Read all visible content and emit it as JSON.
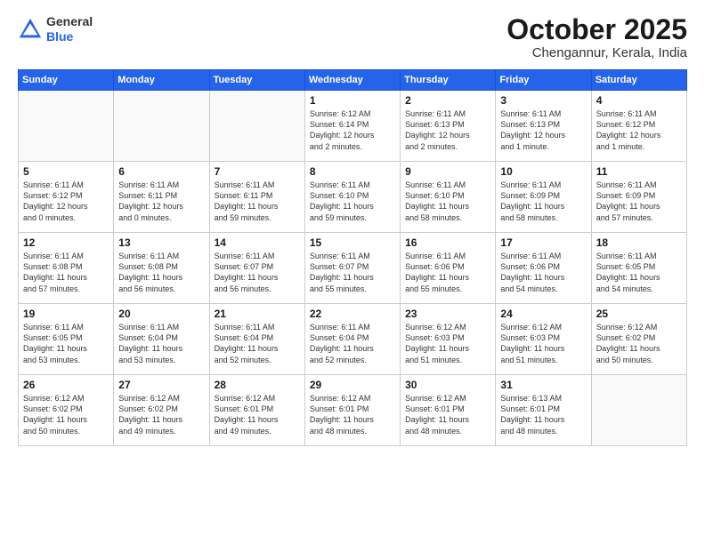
{
  "logo": {
    "general": "General",
    "blue": "Blue"
  },
  "header": {
    "title": "October 2025",
    "subtitle": "Chengannur, Kerala, India"
  },
  "weekdays": [
    "Sunday",
    "Monday",
    "Tuesday",
    "Wednesday",
    "Thursday",
    "Friday",
    "Saturday"
  ],
  "weeks": [
    [
      {
        "day": "",
        "info": ""
      },
      {
        "day": "",
        "info": ""
      },
      {
        "day": "",
        "info": ""
      },
      {
        "day": "1",
        "info": "Sunrise: 6:12 AM\nSunset: 6:14 PM\nDaylight: 12 hours\nand 2 minutes."
      },
      {
        "day": "2",
        "info": "Sunrise: 6:11 AM\nSunset: 6:13 PM\nDaylight: 12 hours\nand 2 minutes."
      },
      {
        "day": "3",
        "info": "Sunrise: 6:11 AM\nSunset: 6:13 PM\nDaylight: 12 hours\nand 1 minute."
      },
      {
        "day": "4",
        "info": "Sunrise: 6:11 AM\nSunset: 6:12 PM\nDaylight: 12 hours\nand 1 minute."
      }
    ],
    [
      {
        "day": "5",
        "info": "Sunrise: 6:11 AM\nSunset: 6:12 PM\nDaylight: 12 hours\nand 0 minutes."
      },
      {
        "day": "6",
        "info": "Sunrise: 6:11 AM\nSunset: 6:11 PM\nDaylight: 12 hours\nand 0 minutes."
      },
      {
        "day": "7",
        "info": "Sunrise: 6:11 AM\nSunset: 6:11 PM\nDaylight: 11 hours\nand 59 minutes."
      },
      {
        "day": "8",
        "info": "Sunrise: 6:11 AM\nSunset: 6:10 PM\nDaylight: 11 hours\nand 59 minutes."
      },
      {
        "day": "9",
        "info": "Sunrise: 6:11 AM\nSunset: 6:10 PM\nDaylight: 11 hours\nand 58 minutes."
      },
      {
        "day": "10",
        "info": "Sunrise: 6:11 AM\nSunset: 6:09 PM\nDaylight: 11 hours\nand 58 minutes."
      },
      {
        "day": "11",
        "info": "Sunrise: 6:11 AM\nSunset: 6:09 PM\nDaylight: 11 hours\nand 57 minutes."
      }
    ],
    [
      {
        "day": "12",
        "info": "Sunrise: 6:11 AM\nSunset: 6:08 PM\nDaylight: 11 hours\nand 57 minutes."
      },
      {
        "day": "13",
        "info": "Sunrise: 6:11 AM\nSunset: 6:08 PM\nDaylight: 11 hours\nand 56 minutes."
      },
      {
        "day": "14",
        "info": "Sunrise: 6:11 AM\nSunset: 6:07 PM\nDaylight: 11 hours\nand 56 minutes."
      },
      {
        "day": "15",
        "info": "Sunrise: 6:11 AM\nSunset: 6:07 PM\nDaylight: 11 hours\nand 55 minutes."
      },
      {
        "day": "16",
        "info": "Sunrise: 6:11 AM\nSunset: 6:06 PM\nDaylight: 11 hours\nand 55 minutes."
      },
      {
        "day": "17",
        "info": "Sunrise: 6:11 AM\nSunset: 6:06 PM\nDaylight: 11 hours\nand 54 minutes."
      },
      {
        "day": "18",
        "info": "Sunrise: 6:11 AM\nSunset: 6:05 PM\nDaylight: 11 hours\nand 54 minutes."
      }
    ],
    [
      {
        "day": "19",
        "info": "Sunrise: 6:11 AM\nSunset: 6:05 PM\nDaylight: 11 hours\nand 53 minutes."
      },
      {
        "day": "20",
        "info": "Sunrise: 6:11 AM\nSunset: 6:04 PM\nDaylight: 11 hours\nand 53 minutes."
      },
      {
        "day": "21",
        "info": "Sunrise: 6:11 AM\nSunset: 6:04 PM\nDaylight: 11 hours\nand 52 minutes."
      },
      {
        "day": "22",
        "info": "Sunrise: 6:11 AM\nSunset: 6:04 PM\nDaylight: 11 hours\nand 52 minutes."
      },
      {
        "day": "23",
        "info": "Sunrise: 6:12 AM\nSunset: 6:03 PM\nDaylight: 11 hours\nand 51 minutes."
      },
      {
        "day": "24",
        "info": "Sunrise: 6:12 AM\nSunset: 6:03 PM\nDaylight: 11 hours\nand 51 minutes."
      },
      {
        "day": "25",
        "info": "Sunrise: 6:12 AM\nSunset: 6:02 PM\nDaylight: 11 hours\nand 50 minutes."
      }
    ],
    [
      {
        "day": "26",
        "info": "Sunrise: 6:12 AM\nSunset: 6:02 PM\nDaylight: 11 hours\nand 50 minutes."
      },
      {
        "day": "27",
        "info": "Sunrise: 6:12 AM\nSunset: 6:02 PM\nDaylight: 11 hours\nand 49 minutes."
      },
      {
        "day": "28",
        "info": "Sunrise: 6:12 AM\nSunset: 6:01 PM\nDaylight: 11 hours\nand 49 minutes."
      },
      {
        "day": "29",
        "info": "Sunrise: 6:12 AM\nSunset: 6:01 PM\nDaylight: 11 hours\nand 48 minutes."
      },
      {
        "day": "30",
        "info": "Sunrise: 6:12 AM\nSunset: 6:01 PM\nDaylight: 11 hours\nand 48 minutes."
      },
      {
        "day": "31",
        "info": "Sunrise: 6:13 AM\nSunset: 6:01 PM\nDaylight: 11 hours\nand 48 minutes."
      },
      {
        "day": "",
        "info": ""
      }
    ]
  ]
}
